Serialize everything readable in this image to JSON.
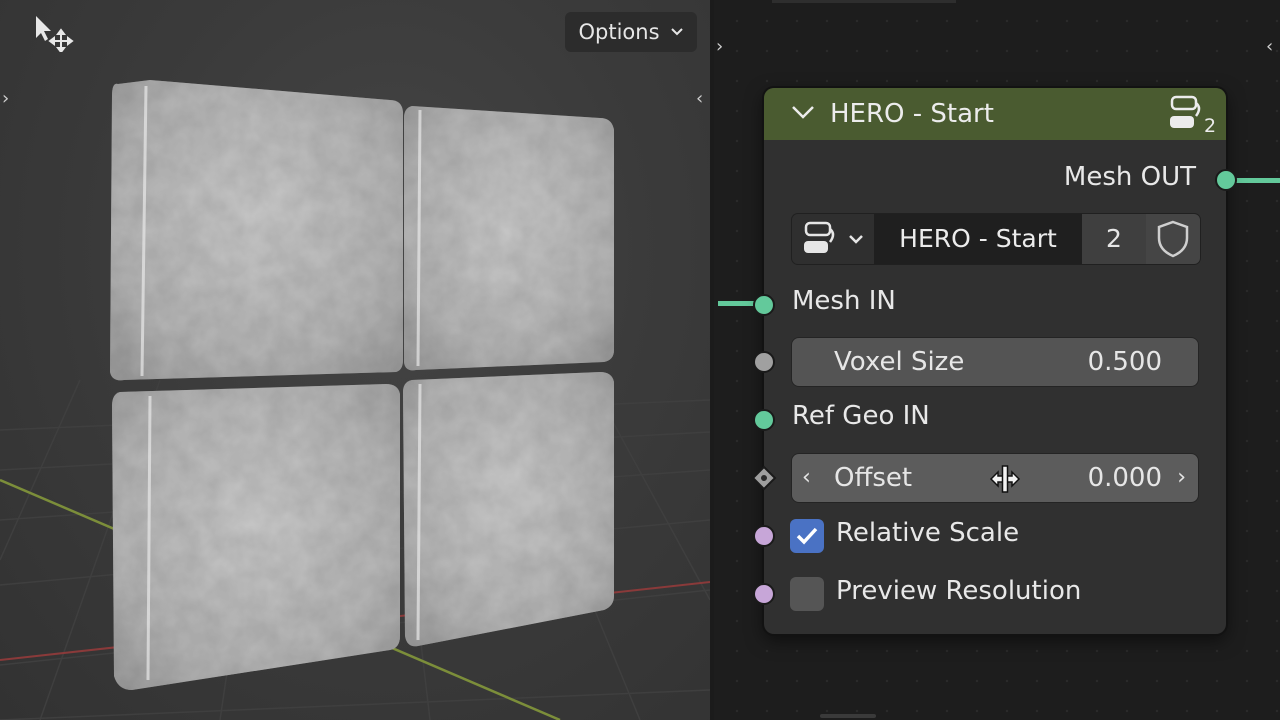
{
  "viewport": {
    "options_label": "Options",
    "tool_icon": "select-move-cursor-icon"
  },
  "node": {
    "title": "HERO - Start",
    "header_badge_count": "2",
    "output_socket_label": "Mesh OUT",
    "selector": {
      "name": "HERO - Start",
      "user_count": "2",
      "icon": "node-group-icon",
      "fake_user_icon": "shield-icon"
    },
    "inputs": {
      "mesh_in": "Mesh IN",
      "voxel_size": {
        "label": "Voxel Size",
        "value": "0.500"
      },
      "ref_geo_in": "Ref Geo IN",
      "offset": {
        "label": "Offset",
        "value": "0.000"
      },
      "relative_scale": {
        "label": "Relative Scale",
        "checked": true
      },
      "preview_resolution": {
        "label": "Preview Resolution",
        "checked": false
      }
    }
  },
  "colors": {
    "header": "#4a5b30",
    "geometry_socket": "#63c99b",
    "float_socket": "#a0a0a0",
    "bool_socket": "#c7a6d8",
    "checkbox_on": "#4a72c4"
  }
}
